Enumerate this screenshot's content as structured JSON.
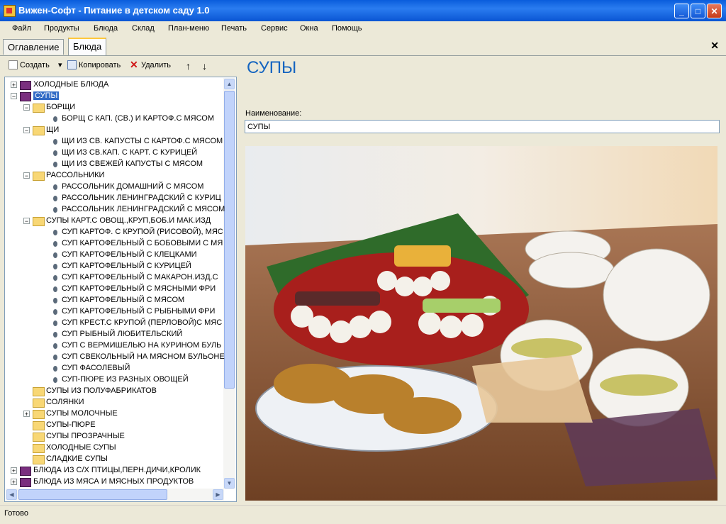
{
  "window": {
    "title": "Вижен-Софт - Питание в детском саду 1.0"
  },
  "menu": [
    "Файл",
    "Продукты",
    "Блюда",
    "Склад",
    "План-меню",
    "Печать",
    "Сервис",
    "Окна",
    "Помощь"
  ],
  "tabs": [
    "Оглавление",
    "Блюда"
  ],
  "toolbar": {
    "create": "Создать",
    "copy": "Копировать",
    "delete": "Удалить"
  },
  "tree": [
    {
      "label": "ХОЛОДНЫЕ БЛЮДА",
      "level": 0,
      "icon": "book-icon",
      "expander": "+"
    },
    {
      "label": "СУПЫ",
      "level": 0,
      "icon": "open-book-icon",
      "expander": "-",
      "selected": true
    },
    {
      "label": "БОРЩИ",
      "level": 1,
      "icon": "folder-icon",
      "expander": "-"
    },
    {
      "label": "БОРЩ С КАП. (СВ.) И КАРТОФ.С МЯСОМ",
      "level": 2,
      "icon": "leaf-icon"
    },
    {
      "label": "ЩИ",
      "level": 1,
      "icon": "folder-icon",
      "expander": "-"
    },
    {
      "label": "ЩИ ИЗ СВ. КАПУСТЫ С КАРТОФ.С МЯСОМ",
      "level": 2,
      "icon": "leaf-icon"
    },
    {
      "label": "ЩИ ИЗ СВ.КАП. С КАРТ. С КУРИЦЕЙ",
      "level": 2,
      "icon": "leaf-icon"
    },
    {
      "label": "ЩИ ИЗ СВЕЖЕЙ КАПУСТЫ С МЯСОМ",
      "level": 2,
      "icon": "leaf-icon"
    },
    {
      "label": "РАССОЛЬНИКИ",
      "level": 1,
      "icon": "folder-icon",
      "expander": "-"
    },
    {
      "label": "РАССОЛЬНИК ДОМАШНИЙ С МЯСОМ",
      "level": 2,
      "icon": "leaf-icon"
    },
    {
      "label": "РАССОЛЬНИК ЛЕНИНГРАДСКИЙ С КУРИЦ",
      "level": 2,
      "icon": "leaf-icon"
    },
    {
      "label": "РАССОЛЬНИК ЛЕНИНГРАДСКИЙ С МЯСОМ",
      "level": 2,
      "icon": "leaf-icon"
    },
    {
      "label": "СУПЫ КАРТ.С ОВОЩ.,КРУП,БОБ.И МАК.ИЗД",
      "level": 1,
      "icon": "folder-icon",
      "expander": "-"
    },
    {
      "label": "СУП КАРТОФ. С КРУПОЙ (РИСОВОЙ), МЯС",
      "level": 2,
      "icon": "leaf-icon"
    },
    {
      "label": "СУП КАРТОФЕЛЬНЫЙ С БОБОВЫМИ С МЯ",
      "level": 2,
      "icon": "leaf-icon"
    },
    {
      "label": "СУП КАРТОФЕЛЬНЫЙ С КЛЕЦКАМИ",
      "level": 2,
      "icon": "leaf-icon"
    },
    {
      "label": "СУП КАРТОФЕЛЬНЫЙ С КУРИЦЕЙ",
      "level": 2,
      "icon": "leaf-icon"
    },
    {
      "label": "СУП КАРТОФЕЛЬНЫЙ С МАКАРОН.ИЗД.С",
      "level": 2,
      "icon": "leaf-icon"
    },
    {
      "label": "СУП КАРТОФЕЛЬНЫЙ С МЯСНЫМИ ФРИ",
      "level": 2,
      "icon": "leaf-icon"
    },
    {
      "label": "СУП КАРТОФЕЛЬНЫЙ С МЯСОМ",
      "level": 2,
      "icon": "leaf-icon"
    },
    {
      "label": "СУП КАРТОФЕЛЬНЫЙ С РЫБНЫМИ ФРИ",
      "level": 2,
      "icon": "leaf-icon"
    },
    {
      "label": "СУП КРЕСТ.С КРУПОЙ (ПЕРЛОВОЙ)С МЯС",
      "level": 2,
      "icon": "leaf-icon"
    },
    {
      "label": "СУП РЫБНЫЙ ЛЮБИТЕЛЬСКИЙ",
      "level": 2,
      "icon": "leaf-icon"
    },
    {
      "label": "СУП С ВЕРМИШЕЛЬЮ НА КУРИНОМ БУЛЬ",
      "level": 2,
      "icon": "leaf-icon"
    },
    {
      "label": "СУП СВЕКОЛЬНЫЙ НА МЯСНОМ БУЛЬОНЕ",
      "level": 2,
      "icon": "leaf-icon"
    },
    {
      "label": "СУП ФАСОЛЕВЫЙ",
      "level": 2,
      "icon": "leaf-icon"
    },
    {
      "label": "СУП-ПЮРЕ ИЗ РАЗНЫХ ОВОЩЕЙ",
      "level": 2,
      "icon": "leaf-icon"
    },
    {
      "label": "СУПЫ ИЗ ПОЛУФАБРИКАТОВ",
      "level": 1,
      "icon": "folder-icon"
    },
    {
      "label": "СОЛЯНКИ",
      "level": 1,
      "icon": "folder-icon"
    },
    {
      "label": "СУПЫ МОЛОЧНЫЕ",
      "level": 1,
      "icon": "folder-icon",
      "expander": "+"
    },
    {
      "label": "СУПЫ-ПЮРЕ",
      "level": 1,
      "icon": "folder-icon"
    },
    {
      "label": "СУПЫ ПРОЗРАЧНЫЕ",
      "level": 1,
      "icon": "folder-icon"
    },
    {
      "label": "ХОЛОДНЫЕ СУПЫ",
      "level": 1,
      "icon": "folder-icon"
    },
    {
      "label": "СЛАДКИЕ СУПЫ",
      "level": 1,
      "icon": "folder-icon"
    },
    {
      "label": "БЛЮДА ИЗ С/Х ПТИЦЫ,ПЕРН.ДИЧИ,КРОЛИК",
      "level": 0,
      "icon": "book-icon",
      "expander": "+"
    },
    {
      "label": "БЛЮДА ИЗ МЯСА И МЯСНЫХ ПРОДУКТОВ",
      "level": 0,
      "icon": "book-icon",
      "expander": "+"
    }
  ],
  "detail": {
    "heading": "СУПЫ",
    "name_label": "Наименование:",
    "name_value": "СУПЫ"
  },
  "status": "Готово"
}
